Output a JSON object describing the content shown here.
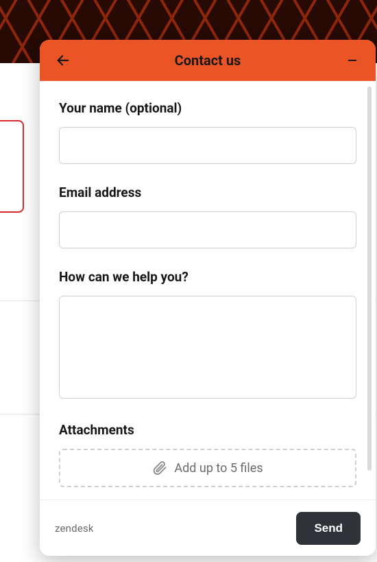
{
  "header": {
    "title": "Contact us"
  },
  "form": {
    "name_label": "Your name (optional)",
    "name_value": "",
    "email_label": "Email address",
    "email_value": "",
    "help_label": "How can we help you?",
    "help_value": "",
    "attachments_label": "Attachments",
    "attachments_hint": "Add up to 5 files"
  },
  "footer": {
    "brand": "zendesk",
    "send_label": "Send"
  }
}
